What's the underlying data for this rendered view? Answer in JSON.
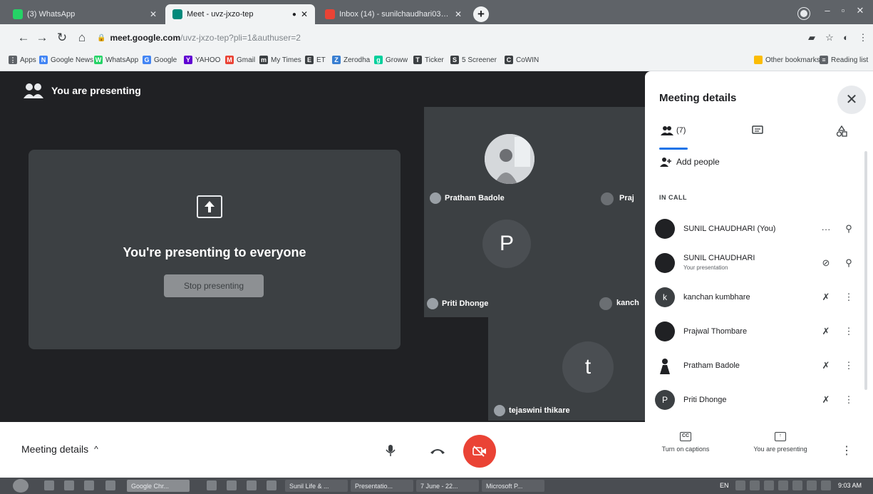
{
  "browser": {
    "tabs": [
      {
        "title": "(3) WhatsApp",
        "active": false,
        "favicon_color": "#25d366"
      },
      {
        "title": "Meet - uvz-jxzo-tep",
        "active": true,
        "favicon_color": "#00897b"
      },
      {
        "title": "Inbox (14) - sunilchaudhari03@...",
        "active": false,
        "favicon_color": "#ea4335"
      }
    ],
    "new_tab": "+",
    "url_domain": "meet.google.com",
    "url_path": "/uvz-jxzo-tep?pli=1&authuser=2",
    "bookmarks": [
      {
        "label": "Apps",
        "icon": "apps-icon",
        "color": "#5f6368"
      },
      {
        "label": "Google News",
        "icon": "google-news-icon",
        "color": "#4285f4"
      },
      {
        "label": "WhatsApp",
        "icon": "whatsapp-icon",
        "color": "#25d366"
      },
      {
        "label": "Google",
        "icon": "google-icon",
        "color": "#4285f4"
      },
      {
        "label": "YAHOO",
        "icon": "yahoo-icon",
        "color": "#6001d2"
      },
      {
        "label": "Gmail",
        "icon": "gmail-icon",
        "color": "#ea4335"
      },
      {
        "label": "My Times",
        "icon": "mytimes-icon",
        "color": "#3c4043"
      },
      {
        "label": "ET",
        "icon": "et-icon",
        "color": "#3c4043"
      },
      {
        "label": "Zerodha",
        "icon": "zerodha-icon",
        "color": "#387ed1"
      },
      {
        "label": "Groww",
        "icon": "groww-icon",
        "color": "#00d09c"
      },
      {
        "label": "Ticker",
        "icon": "ticker-icon",
        "color": "#3c4043"
      },
      {
        "label": "5 Screener",
        "icon": "screener-icon",
        "color": "#3c4043"
      },
      {
        "label": "CoWIN",
        "icon": "cowin-icon",
        "color": "#3c4043"
      }
    ],
    "other_bookmarks": "Other bookmarks",
    "reading_list": "Reading list"
  },
  "meet": {
    "presenting_header": "You are presenting",
    "present_message": "You're presenting to everyone",
    "stop_presenting": "Stop presenting",
    "tiles": {
      "tile1_name": "Pratham Badole",
      "tile1_edge": "Praj",
      "tile2_letter": "P",
      "tile2_name": "Priti Dhonge",
      "tile2_edge": "kanch",
      "tile3_letter": "t",
      "tile3_name": "tejaswini thikare"
    }
  },
  "side_panel": {
    "title": "Meeting details",
    "people_count": "(7)",
    "add_people": "Add people",
    "in_call": "IN CALL",
    "participants": [
      {
        "name": "SUNIL CHAUDHARI (You)",
        "sub": "",
        "avatar": "",
        "avatar_color": "#202124",
        "action1": "more-dots-icon",
        "action2": "pin-icon"
      },
      {
        "name": "SUNIL CHAUDHARI",
        "sub": "Your presentation",
        "avatar": "",
        "avatar_color": "#202124",
        "action1": "present-muted-icon",
        "action2": "pin-icon"
      },
      {
        "name": "kanchan kumbhare",
        "sub": "",
        "avatar": "k",
        "avatar_color": "#3c4043",
        "action1": "mic-off-icon",
        "action2": "kebab-icon"
      },
      {
        "name": "Prajwal Thombare",
        "sub": "",
        "avatar": "",
        "avatar_color": "#202124",
        "action1": "mic-off-icon",
        "action2": "kebab-icon"
      },
      {
        "name": "Pratham Badole",
        "sub": "",
        "avatar": "",
        "avatar_color": "#ffffff",
        "action1": "mic-off-icon",
        "action2": "kebab-icon"
      },
      {
        "name": "Priti Dhonge",
        "sub": "",
        "avatar": "P",
        "avatar_color": "#3c4043",
        "action1": "mic-off-icon",
        "action2": "kebab-icon"
      }
    ]
  },
  "bottom": {
    "meeting_details": "Meeting details",
    "captions": "Turn on captions",
    "you_are_presenting": "You are presenting",
    "cam_color": "#ea4335"
  },
  "taskbar": {
    "items": [
      "Google Chr...",
      "Sunil Life & ...",
      "Presentatio...",
      "7 June - 22...",
      "Microsoft P..."
    ],
    "lang": "EN",
    "clock": "9:03 AM"
  }
}
